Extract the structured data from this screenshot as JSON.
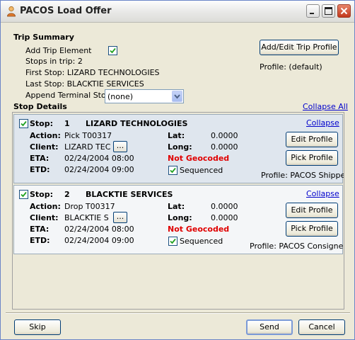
{
  "window": {
    "title": "PACOS Load Offer"
  },
  "trip_summary": {
    "heading": "Trip Summary",
    "add_trip_element_label": "Add Trip Element",
    "add_trip_element_checked": true,
    "stops_in_trip": "Stops in trip: 2",
    "first_stop": "First Stop: LIZARD TECHNOLOGIES",
    "last_stop": "Last Stop: BLACKTIE SERVICES",
    "append_terminal_label": "Append Terminal Stop:",
    "append_terminal_value": "(none)",
    "profile_button": "Add/Edit Trip Profile",
    "profile_text": "Profile:  (default)"
  },
  "stop_details": {
    "heading": "Stop Details",
    "collapse_all": "Collapse All",
    "stops": [
      {
        "stop_label": "Stop:",
        "number": "1",
        "name": "LIZARD TECHNOLOGIES",
        "collapse": "Collapse",
        "action_label": "Action:",
        "action_value": "Pick T00317",
        "client_label": "Client:",
        "client_value": "LIZARD TEC",
        "ellipsis": "...",
        "eta_label": "ETA:",
        "eta_value": "02/24/2004 08:00",
        "etd_label": "ETD:",
        "etd_value": "02/24/2004 09:00",
        "lat_label": "Lat:",
        "lat_value": "0.0000",
        "long_label": "Long:",
        "long_value": "0.0000",
        "geocode_status": "Not Geocoded",
        "sequenced_label": "Sequenced",
        "edit_profile": "Edit Profile",
        "pick_profile": "Pick Profile",
        "profile": "Profile: PACOS Shipper"
      },
      {
        "stop_label": "Stop:",
        "number": "2",
        "name": "BLACKTIE SERVICES",
        "collapse": "Collapse",
        "action_label": "Action:",
        "action_value": "Drop T00317",
        "client_label": "Client:",
        "client_value": "BLACKTIE S",
        "ellipsis": "...",
        "eta_label": "ETA:",
        "eta_value": "02/24/2004 08:00",
        "etd_label": "ETD:",
        "etd_value": "02/24/2004 09:00",
        "lat_label": "Lat:",
        "lat_value": "0.0000",
        "long_label": "Long:",
        "long_value": "0.0000",
        "geocode_status": "Not Geocoded",
        "sequenced_label": "Sequenced",
        "edit_profile": "Edit Profile",
        "pick_profile": "Pick Profile",
        "profile": "Profile: PACOS Consignee"
      }
    ]
  },
  "footer": {
    "skip": "Skip",
    "send": "Send",
    "cancel": "Cancel"
  },
  "colors": {
    "warning": "#e00000",
    "link": "#0000cc",
    "stop1_bg": "#dfe6ee"
  },
  "icons": {
    "app": "person-icon",
    "minimize": "minimize-icon",
    "maximize": "maximize-icon",
    "close": "close-icon",
    "check": "check-icon",
    "dropdown": "chevron-down-icon"
  }
}
